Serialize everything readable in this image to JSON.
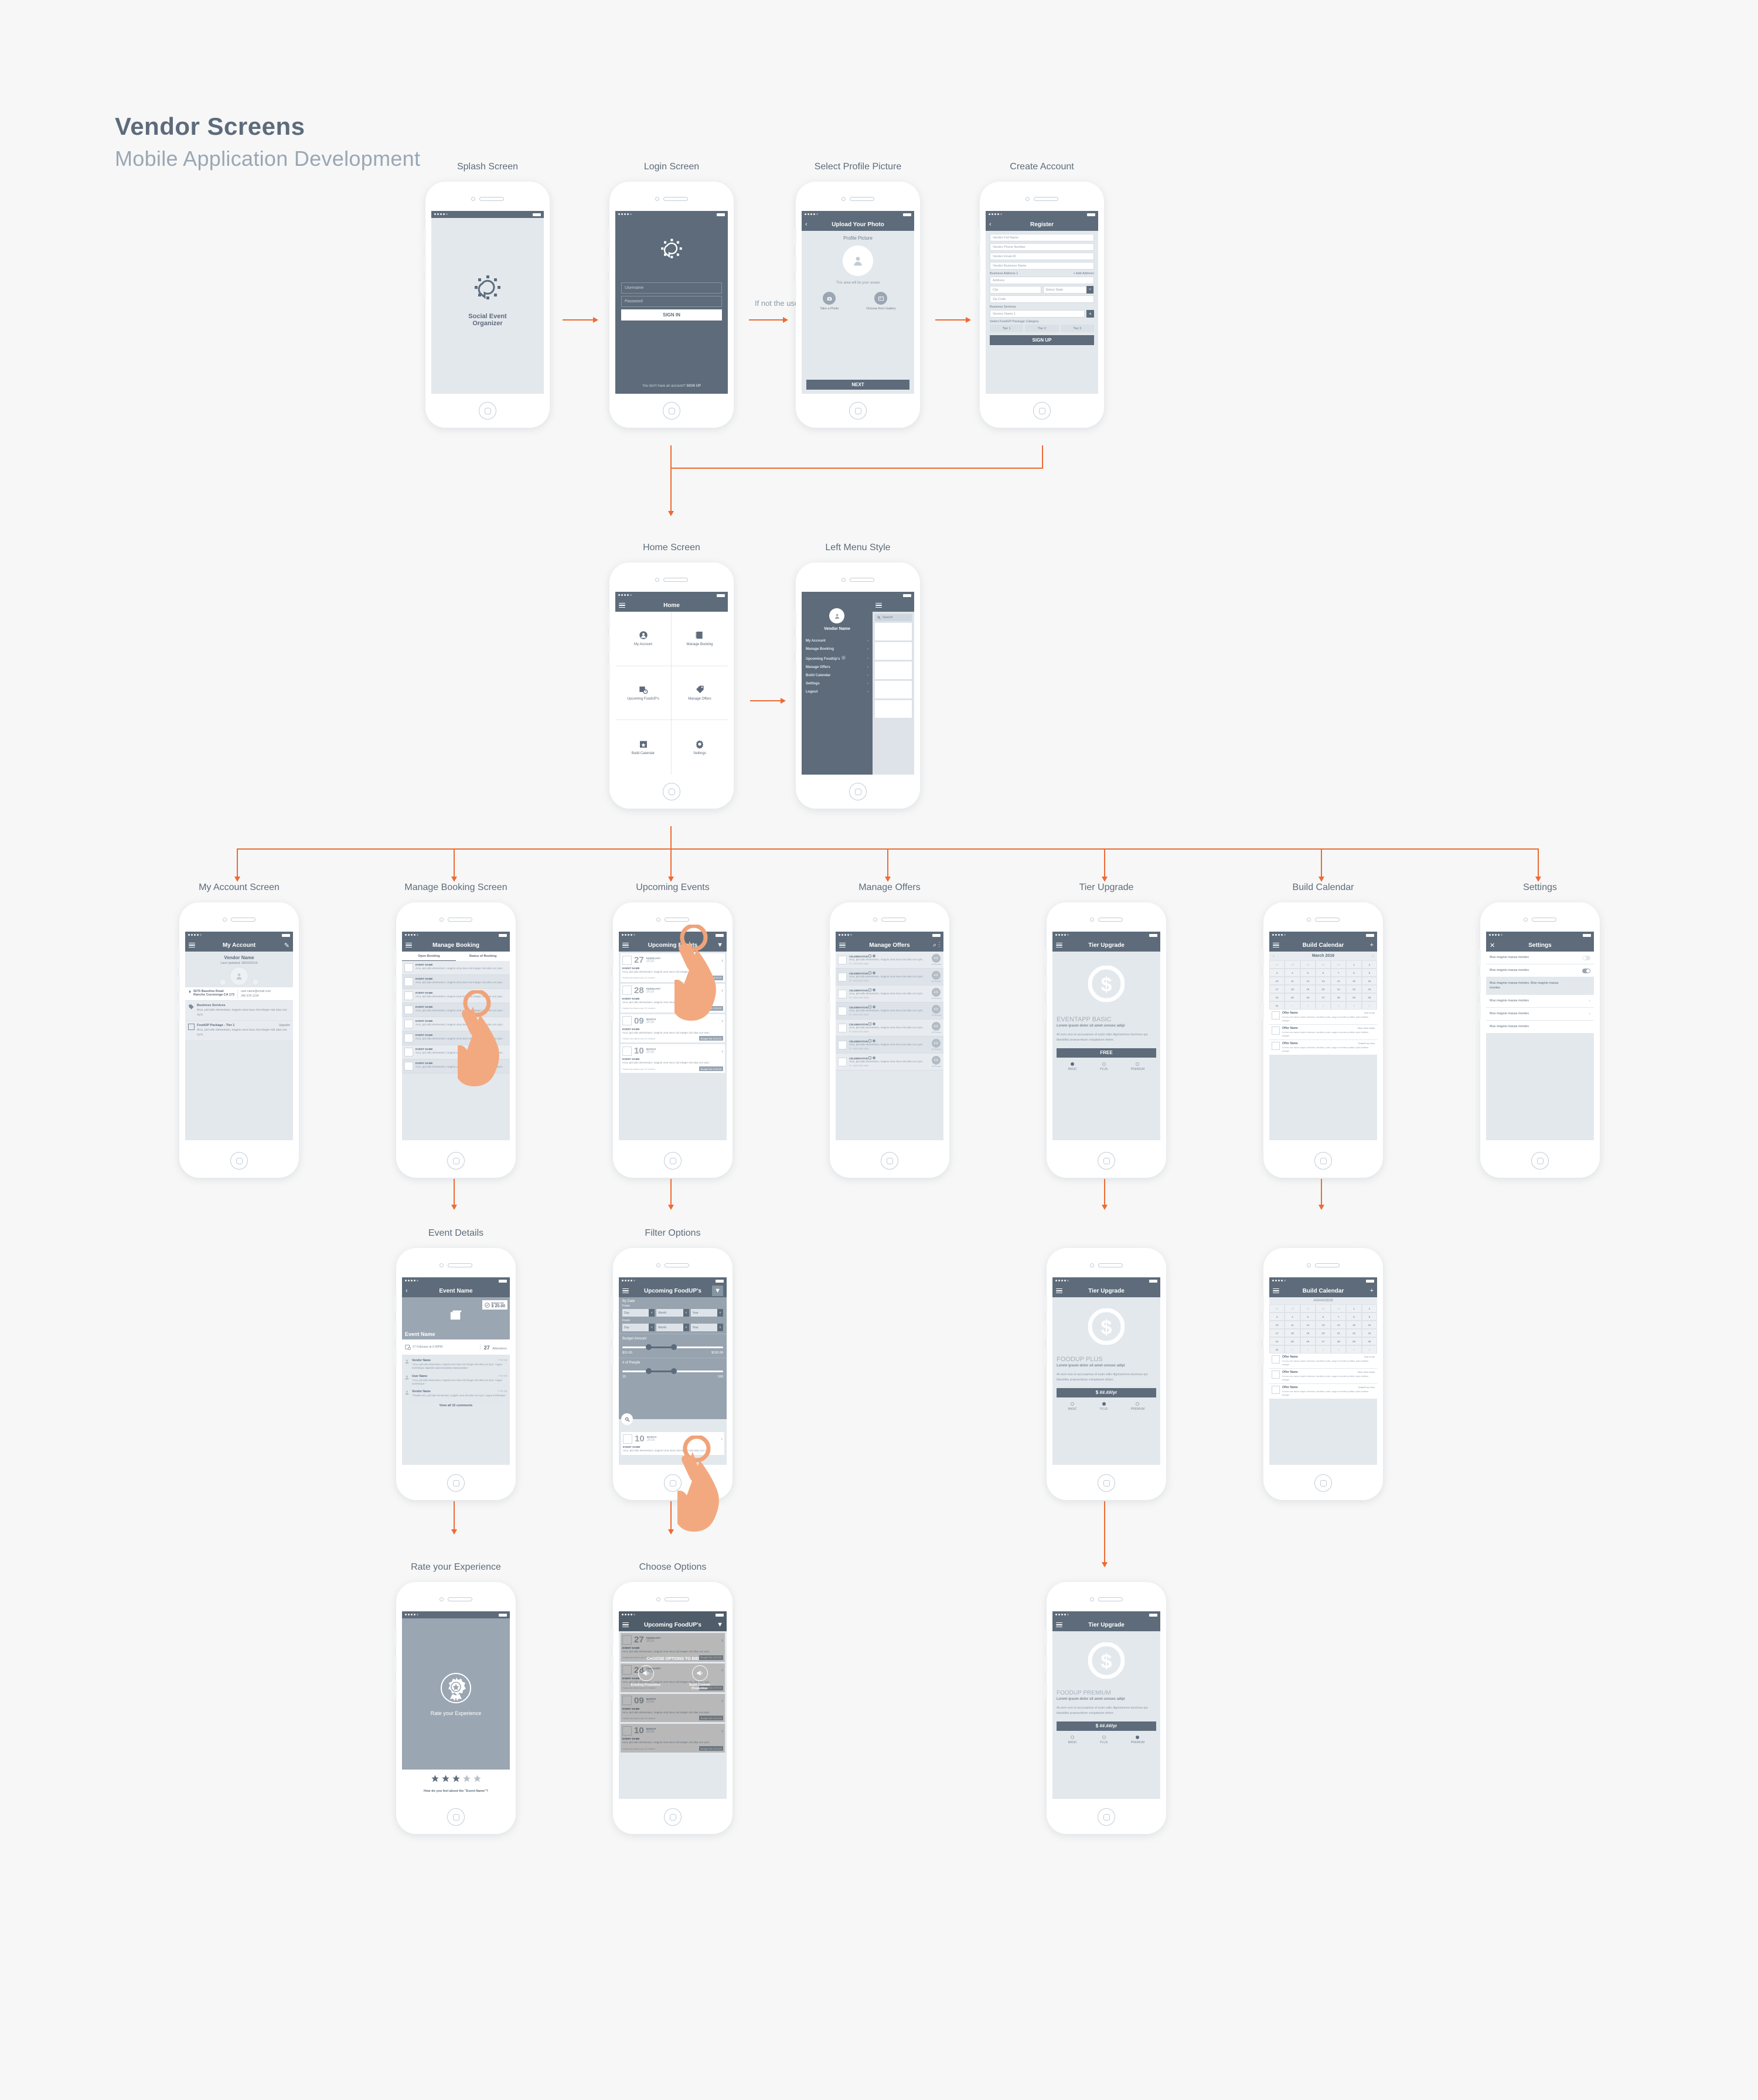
{
  "header": {
    "title": "Vendor Screens",
    "subtitle": "Mobile Application Development"
  },
  "flow_labels": {
    "if_not_user": "If not the user"
  },
  "captions": {
    "splash": "Splash Screen",
    "login": "Login Screen",
    "profile": "Select Profile Picture",
    "create": "Create Account",
    "home": "Home Screen",
    "menu": "Left Menu Style",
    "account": "My Account Screen",
    "booking": "Manage Booking Screen",
    "events": "Upcoming Events",
    "offers": "Manage Offers",
    "tier": "Tier Upgrade",
    "calendar": "Build Calendar",
    "settings": "Settings",
    "event_details": "Event Details",
    "filter": "Filter Options",
    "rate": "Rate your Experience",
    "choose": "Choose Options"
  },
  "splash": {
    "title_line1": "Social Event",
    "title_line2": "Organizer"
  },
  "login": {
    "username_placeholder": "Username",
    "password_placeholder": "Password",
    "signin": "SIGN IN",
    "footer_text": "You don't have an account?",
    "signup_link": "SIGN UP"
  },
  "profile": {
    "nav_title": "Upload Your Photo",
    "section": "Profile Picture",
    "avatar_note": "This area will be your avatar",
    "take_photo": "Take a Photo",
    "gallery": "Choose from Gallery",
    "next": "NEXT"
  },
  "register": {
    "nav_title": "Register",
    "fields": [
      "Vendor Full Name",
      "Vendor Phone Number",
      "Vendor Email-ID",
      "Vendor Business Name"
    ],
    "address_label": "Business Address 1",
    "add_address": "+ Add Address",
    "address": "Address",
    "city": "City",
    "state": "Select State",
    "zip": "Zip Code",
    "services_label": "Business Services",
    "service_name": "Service Name 1",
    "package_label": "Select FoodUP Package Category",
    "tiers": [
      "Tier 1",
      "Tier 2",
      "Tier 3"
    ],
    "signup": "SIGN UP"
  },
  "home": {
    "nav_title": "Home",
    "tiles": [
      {
        "label": "My Account",
        "icon": "person-circle-icon"
      },
      {
        "label": "Manage Booking",
        "icon": "book-icon"
      },
      {
        "label": "Upcoming FoodUP's",
        "icon": "calendar-clock-icon"
      },
      {
        "label": "Manage Offers",
        "icon": "tag-icon"
      },
      {
        "label": "Build Calendar",
        "icon": "calendar-star-icon"
      },
      {
        "label": "Settings",
        "icon": "gear-icon"
      }
    ]
  },
  "left_menu": {
    "vendor_name": "Vendor Name",
    "search_placeholder": "Search",
    "items": [
      "My Account",
      "Manage Booking",
      "Upcoming FoodUp's",
      "Manage Offers",
      "Build Calendar",
      "Settings",
      "Logout"
    ]
  },
  "my_account": {
    "nav_title": "My Account",
    "vendor_name": "Vendor Name",
    "last_updated": "Last Updated: 08/02/2016",
    "address_line1": "9275 Baseline Road",
    "address_line2": "Rancho Cucmonga CA 173",
    "email": "user.name@email.com",
    "phone": "345 678 1234",
    "services_title": "Business Services",
    "services_text": "Arcu, pid odio elementum, magnis urna risus nisi integer nisi alsa con sync.",
    "package_title": "FoodUP Package - Tier 1",
    "upgrade": "Upgrade",
    "package_text": "Arcu, pid odio elementum, magnis urna risus nisi integer nisi alsa con sync."
  },
  "manage_booking": {
    "nav_title": "Manage Booking",
    "tabs": [
      "Open Booking",
      "Status of Booking"
    ],
    "item_title": "EVENT NAME",
    "item_text": "Arcu, pid odio elementum, magnis urna risus nisi integer nisi alsa con sync.",
    "rows": 8
  },
  "upcoming_events": {
    "nav_title": "Upcoming Events",
    "item_title": "EVENT NAME",
    "item_text": "Arcu, pid odio elementum, magnis urna risus nisi integer nisi alsa con sync.",
    "hosted": "Hosted by Name and 21 invited",
    "budget": "Budget Set: $ 20.00",
    "events": [
      {
        "day": "27",
        "month": "FEBRUARY",
        "year": "2016"
      },
      {
        "day": "28",
        "month": "FEBRUARY",
        "year": "2016"
      },
      {
        "day": "09",
        "month": "MARCH",
        "year": "2016"
      },
      {
        "day": "10",
        "month": "MARCH",
        "year": "2016"
      }
    ]
  },
  "manage_offers": {
    "nav_title": "Manage Offers",
    "item_title": "CELEBRATION",
    "item_text": "Arcu, pid odio elementum, magnis urna risus nisi alsa con sync.",
    "phone": "+1000 000 0000",
    "rating": "4.5",
    "reviews": "89 Review",
    "rows": 7
  },
  "tier_basic": {
    "nav_title": "Tier Upgrade",
    "plan": "EVENTAPP BASIC",
    "tagline": "Lorem ipsum dolor sit amet consec adipi",
    "desc": "At vero eos et accusamus et iusto odio dignissimos ducimus qui blanditiis praesentium voluptatum delen.",
    "price": "FREE",
    "tabs": [
      "BASIC",
      "PLUS",
      "PREMIUM"
    ],
    "active": 0
  },
  "tier_plus": {
    "nav_title": "Tier Upgrade",
    "plan": "FOODUP PLUS",
    "tagline": "Lorem ipsum dolor sit amet consec adipi",
    "desc": "At vero eos et accusamus et iusto odio dignissimos ducimus qui blanditiis praesentium voluptatum delen.",
    "price": "$ ##.##/yr",
    "tabs": [
      "BASIC",
      "PLUS",
      "PREMIUM"
    ],
    "active": 1
  },
  "tier_premium": {
    "nav_title": "Tier Upgrade",
    "plan": "FOODUP PREMIUM",
    "tagline": "Lorem ipsum dolor sit amet consec adipi",
    "desc": "At vero eos et accusamus et iusto odio dignissimos ducimus qui blanditiis praesentium voluptatum delen.",
    "price": "$ ##.##/yr",
    "tabs": [
      "BASIC",
      "PLUS",
      "PREMIUM"
    ],
    "active": 2
  },
  "calendar": {
    "nav_title": "Build Calendar",
    "month": "March 2016",
    "weeks": [
      [
        "28",
        "29",
        "28",
        "30",
        "30",
        "1",
        "2"
      ],
      [
        "3",
        "4",
        "5",
        "6",
        "7",
        "8",
        "9"
      ],
      [
        "10",
        "11",
        "12",
        "13",
        "14",
        "15",
        "16"
      ],
      [
        "17",
        "18",
        "19",
        "20",
        "21",
        "22",
        "23"
      ],
      [
        "24",
        "25",
        "26",
        "27",
        "28",
        "29",
        "30"
      ],
      [
        "31",
        "1",
        "2",
        "3",
        "4",
        "5",
        "6"
      ]
    ],
    "offers": [
      {
        "name": "Offer Name",
        "tag": "%off of bill",
        "text": "A eros nec lacus turpis ridiculus, landiem porta, augue montes porttitor quis facilisis integer."
      },
      {
        "name": "Offer Name",
        "tag": "Menu item deals",
        "text": "A eros nec lacus turpis ridiculus, landiem porta, augue montes porttitor quis facilisis integer."
      },
      {
        "name": "Offer Name",
        "tag": "Deals/Free item",
        "text": "A eros nec lacus turpis ridiculus, landiem porta, augue montes porttitor quis facilisis integer."
      }
    ]
  },
  "calendar2": {
    "nav_title": "Build Calendar",
    "month": "##/###/2016"
  },
  "settings": {
    "nav_title": "Settings",
    "rows": [
      {
        "label": "Mus magnis massa montes",
        "type": "toggle",
        "on": false
      },
      {
        "label": "Mus magnis massa montes",
        "type": "toggle",
        "on": true
      },
      {
        "label": "Mus magnis massa montes, Mus magnis massa montes",
        "type": "text"
      },
      {
        "label": "Mus magnis massa montes",
        "type": "chevron"
      },
      {
        "label": "Mus magnis massa montes",
        "type": "chevron"
      },
      {
        "label": "Mus magnis massa montes",
        "type": "text"
      }
    ]
  },
  "event_details": {
    "nav_title": "Event Name",
    "hero_title": "Event Name",
    "budget_label": "Budget Set",
    "budget_value": "$ 20.00",
    "date": "27 February at 0.00PM",
    "attendees_count": "27",
    "attendees_label": "Attendees",
    "view_all": "View all 15 comments",
    "comments": [
      {
        "name": "Vendor Name",
        "time": "1 day ago",
        "text": "\"Arcu, pid odio elementum, magnis urna risus nisi integer nisi alsa con sync. Augue scelerisque dignissim placerat platea massa platea.\""
      },
      {
        "name": "User Name",
        "time": "1 day ago",
        "text": "\"Arcu, pid odio elementum, magnis urna risus nisi integer nisi alsa con sync. Augue scelerisque.\""
      },
      {
        "name": "Vendor Name",
        "time": "1 day ago",
        "text": "\"Thanks Arcu, pid odio elementum, magnis urna nisi alsa con sync. Augue scelerisque."
      }
    ]
  },
  "filter": {
    "nav_title": "Upcoming FoodUP's",
    "by_date": "By Date",
    "from1": "From",
    "from2": "From",
    "day": "Day",
    "month": "Month",
    "year": "Year",
    "budget_label": "Budget Amount",
    "budget_min": "$15.00",
    "budget_max": "$150.00",
    "people_label": "# of People",
    "people_min": "15",
    "people_max": "150",
    "event_day": "10",
    "event_month": "MARCH",
    "event_year": "2016",
    "item_title": "EVENT NAME",
    "item_text": "Arcu, pid odio elementum, magnis urna risus nisi integer nisi alsa con sync.",
    "hosted": "Hosted by Name and 21 invited",
    "budget": "Budget Set: $ 20.00"
  },
  "rate": {
    "title": "Rate your Experience",
    "question": "How do you feel about the \"Event Name\"?",
    "stars_filled": 3,
    "stars_total": 5
  },
  "choose": {
    "nav_title": "Upcoming FoodUP's",
    "overlay_title": "CHOOSE OPTIONS TO BID",
    "opt1": "Existing Promotion",
    "opt2": "Build Custom Promotion",
    "item_title": "EVENT NAME",
    "item_text": "Arcu, pid odio elementum, magnis urna risus nisi integer nisi alsa con sync.",
    "hosted": "Hosted by Name and 21 invited",
    "budget": "Budget Set: $ 20.00",
    "events": [
      {
        "day": "27",
        "month": "FEBRUARY",
        "year": "2016"
      },
      {
        "day": "28",
        "month": "FEBRUARY",
        "year": "2016"
      },
      {
        "day": "09",
        "month": "MARCH",
        "year": "2016"
      },
      {
        "day": "10",
        "month": "MARCH",
        "year": "2016"
      }
    ]
  },
  "colors": {
    "accent": "#ef6a33",
    "slate": "#5d6b7a",
    "light": "#e3e8ed",
    "mid": "#97a3ae"
  }
}
